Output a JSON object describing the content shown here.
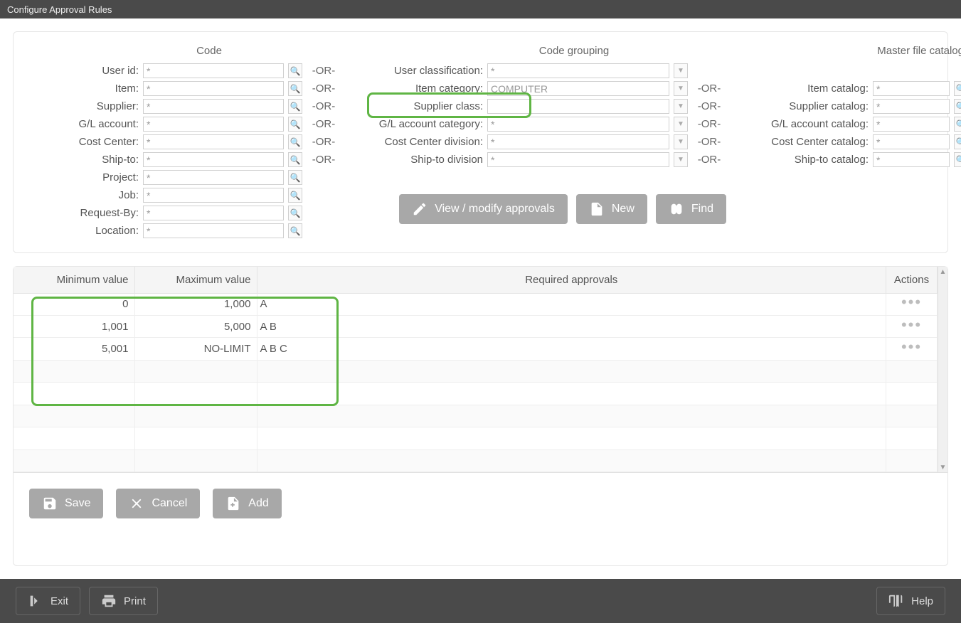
{
  "title": "Configure Approval Rules",
  "headers": {
    "code": "Code",
    "grouping": "Code grouping",
    "catalog": "Master file catalog"
  },
  "labels": {
    "user_id": "User id:",
    "item": "Item:",
    "supplier": "Supplier:",
    "gl": "G/L account:",
    "cost_center": "Cost Center:",
    "ship_to": "Ship-to:",
    "project": "Project:",
    "job": "Job:",
    "request_by": "Request-By:",
    "location": "Location:",
    "user_class": "User classification:",
    "item_cat": "Item category:",
    "supplier_class": "Supplier class:",
    "gl_cat": "G/L account category:",
    "cc_div": "Cost Center division:",
    "ship_div": "Ship-to division",
    "item_catalog": "Item catalog:",
    "supplier_catalog": "Supplier catalog:",
    "gl_catalog": "G/L account catalog:",
    "cc_catalog": "Cost Center catalog:",
    "ship_catalog": "Ship-to catalog:"
  },
  "values": {
    "star": "*",
    "item_cat": "COMPUTER",
    "supplier_class": "",
    "or": "-OR-"
  },
  "buttons": {
    "view": "View / modify approvals",
    "new": "New",
    "find": "Find",
    "save": "Save",
    "cancel": "Cancel",
    "add": "Add",
    "exit": "Exit",
    "print": "Print",
    "help": "Help"
  },
  "tableHeaders": {
    "min": "Minimum value",
    "max": "Maximum value",
    "req": "Required approvals",
    "act": "Actions"
  },
  "rows": [
    {
      "min": "0",
      "max": "1,000",
      "req": "A"
    },
    {
      "min": "1,001",
      "max": "5,000",
      "req": "A B"
    },
    {
      "min": "5,001",
      "max": "NO-LIMIT",
      "req": "A B C"
    }
  ]
}
